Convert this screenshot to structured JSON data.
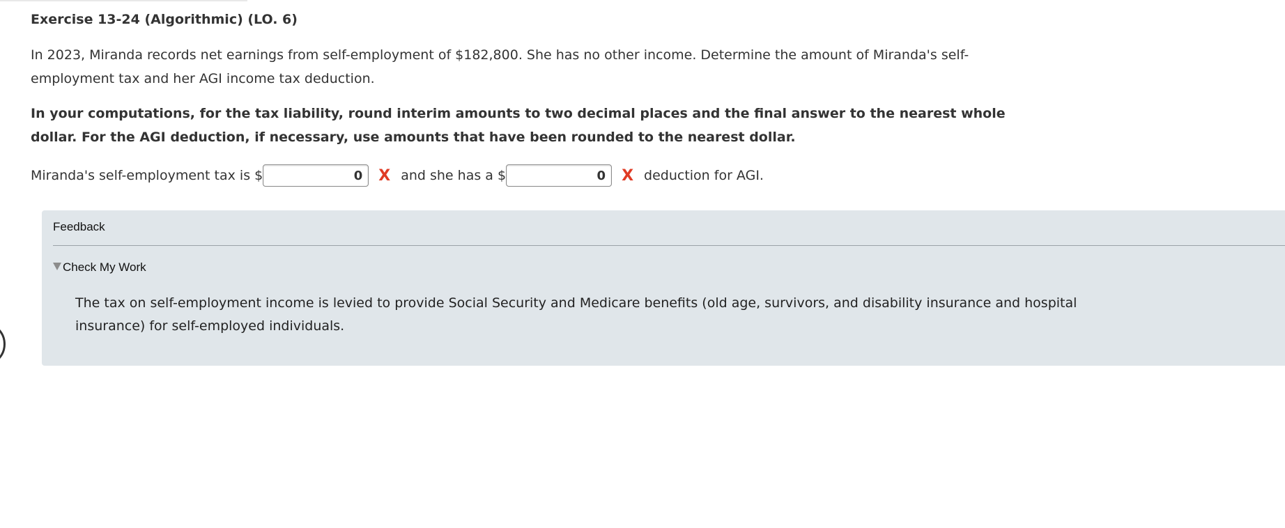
{
  "exercise": {
    "title": "Exercise 13-24 (Algorithmic) (LO. 6)",
    "prompt": "In 2023, Miranda records net earnings from self-employment of $182,800. She has no other income. Determine the amount of Miranda's self-employment tax and her AGI income tax deduction.",
    "instruction": "In your computations, for the tax liability, round interim amounts to two decimal places and the final answer to the nearest whole dollar. For the AGI deduction, if necessary, use amounts that have been rounded to the nearest dollar."
  },
  "answer": {
    "text_before_first": "Miranda's self-employment tax is $",
    "first_value": "0",
    "first_status": "X",
    "text_between": "and she has a $",
    "second_value": "0",
    "second_status": "X",
    "text_after": "deduction for AGI."
  },
  "feedback": {
    "heading": "Feedback",
    "toggle_label": "Check My Work",
    "toggle_icon": "triangle-down-icon",
    "body": "The tax on self-employment income is levied to provide Social Security and Medicare benefits (old age, survivors, and disability insurance and hospital insurance) for self-employed individuals."
  },
  "colors": {
    "incorrect_mark": "#e03b24",
    "feedback_background": "#e0e6ea",
    "text": "#333333"
  }
}
